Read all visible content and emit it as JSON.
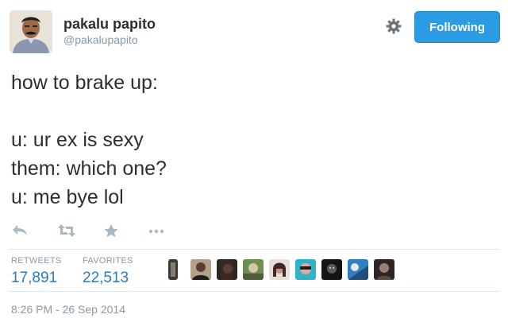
{
  "user": {
    "display_name": "pakalu papito",
    "handle": "@pakalupapito"
  },
  "follow_button": {
    "label": "Following"
  },
  "tweet": {
    "lines": [
      "how to brake up:",
      "",
      "u: ur ex is sexy",
      "them: which one?",
      "u: me bye lol"
    ]
  },
  "stats": {
    "retweets_label": "RETWEETS",
    "retweets_count": "17,891",
    "favorites_label": "FAVORITES",
    "favorites_count": "22,513"
  },
  "timestamp": "8:26 PM - 26 Sep 2014",
  "icons": {
    "reply": "reply-icon",
    "retweet": "retweet-icon",
    "favorite": "star-icon",
    "more": "more-icon",
    "settings": "gear-icon"
  },
  "colors": {
    "follow_button_bg": "#2b9be3",
    "link_blue": "#2b7bb9",
    "muted_gray": "#8899a6",
    "text": "#292f33"
  }
}
